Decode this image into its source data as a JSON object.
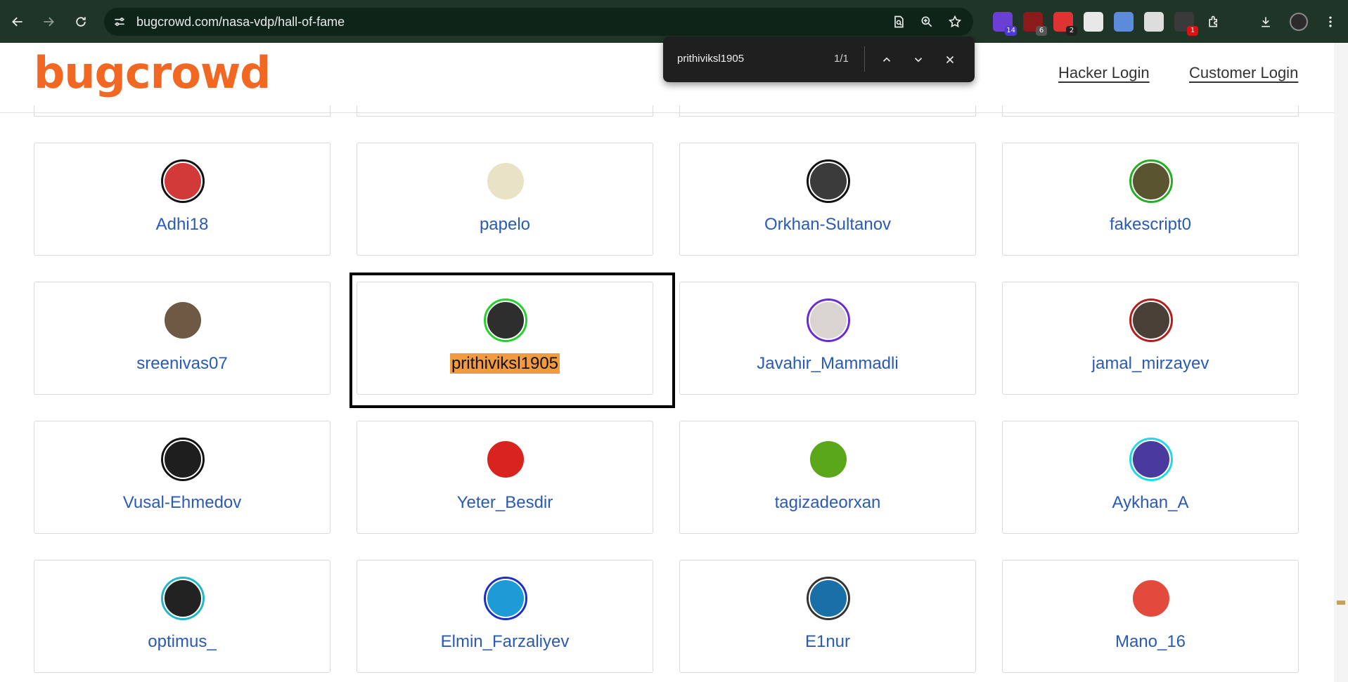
{
  "browser": {
    "url": "bugcrowd.com/nasa-vdp/hall-of-fame",
    "extensions": [
      {
        "name": "ext-purple",
        "color": "#6b3fd1",
        "badge": "14",
        "badge_color": "#4b3bd6"
      },
      {
        "name": "ext-ublock",
        "color": "#8b1a1a",
        "badge": "6",
        "badge_color": "#555555"
      },
      {
        "name": "ext-dice",
        "color": "#d33",
        "badge": "2",
        "badge_color": "#222222"
      },
      {
        "name": "ext-stop",
        "color": "#e8e8e8",
        "badge": "",
        "badge_color": ""
      },
      {
        "name": "ext-globe",
        "color": "#5b8bd9",
        "badge": "",
        "badge_color": ""
      },
      {
        "name": "ext-qr",
        "color": "#dddddd",
        "badge": "",
        "badge_color": ""
      },
      {
        "name": "ext-red",
        "color": "#3a3a3a",
        "badge": "1",
        "badge_color": "#d11"
      }
    ]
  },
  "find": {
    "query": "prithiviksl1905",
    "count": "1/1"
  },
  "header": {
    "logo": "bugcrowd",
    "hacker_login": "Hacker Login",
    "customer_login": "Customer Login"
  },
  "colors": {
    "brand": "#f26822",
    "link": "#2a5ab8",
    "highlight": "#f29a3e"
  },
  "researchers": [
    {
      "name": "Adhi18",
      "ring": "#111111",
      "fill": "#d23a3a",
      "highlighted": false
    },
    {
      "name": "papelo",
      "ring": "#ffffff",
      "fill": "#e9e2c6",
      "highlighted": false
    },
    {
      "name": "Orkhan-Sultanov",
      "ring": "#111111",
      "fill": "#3b3b3b",
      "highlighted": false
    },
    {
      "name": "fakescript0",
      "ring": "#22b022",
      "fill": "#5a5430",
      "highlighted": false
    },
    {
      "name": "sreenivas07",
      "ring": "#ffffff",
      "fill": "#6e5a44",
      "highlighted": false
    },
    {
      "name": "prithiviksl1905",
      "ring": "#22d22b",
      "fill": "#2e2e2e",
      "highlighted": true
    },
    {
      "name": "Javahir_Mammadli",
      "ring": "#6a2bd6",
      "fill": "#d9d4d0",
      "highlighted": false
    },
    {
      "name": "jamal_mirzayev",
      "ring": "#b51c1c",
      "fill": "#4a4038",
      "highlighted": false
    },
    {
      "name": "Vusal-Ehmedov",
      "ring": "#111111",
      "fill": "#1e1e1e",
      "highlighted": false
    },
    {
      "name": "Yeter_Besdir",
      "ring": "#ffffff",
      "fill": "#d8231f",
      "highlighted": false
    },
    {
      "name": "tagizadeorxan",
      "ring": "#ffffff",
      "fill": "#5aa81a",
      "highlighted": false
    },
    {
      "name": "Aykhan_A",
      "ring": "#21d8e8",
      "fill": "#4b3a9e",
      "highlighted": false
    },
    {
      "name": "optimus_",
      "ring": "#20b7c9",
      "fill": "#222222",
      "highlighted": false
    },
    {
      "name": "Elmin_Farzaliyev",
      "ring": "#1a2fc7",
      "fill": "#1c9bd6",
      "highlighted": false
    },
    {
      "name": "E1nur",
      "ring": "#333333",
      "fill": "#1b6fa8",
      "highlighted": false
    },
    {
      "name": "Mano_16",
      "ring": "#ffffff",
      "fill": "#e24a3c",
      "highlighted": false
    }
  ]
}
